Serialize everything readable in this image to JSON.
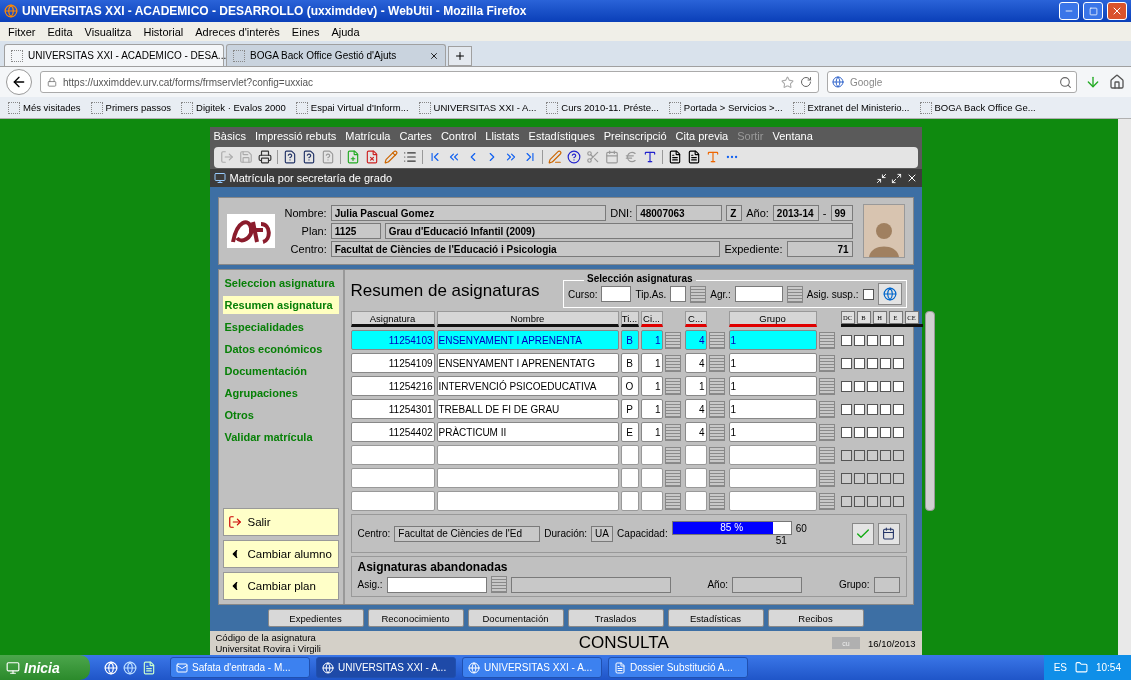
{
  "browser": {
    "title": "UNIVERSITAS XXI - ACADEMICO - DESARROLLO (uxximddev) - WebUtil - Mozilla Firefox",
    "menu": [
      {
        "label": "Fitxer"
      },
      {
        "label": "Edita"
      },
      {
        "label": "Visualitza"
      },
      {
        "label": "Historial"
      },
      {
        "label": "Adreces d'interès"
      },
      {
        "label": "Eines"
      },
      {
        "label": "Ajuda"
      }
    ],
    "tabs": [
      {
        "label": "UNIVERSITAS XXI - ACADEMICO - DESA...",
        "selected": true
      },
      {
        "label": "BOGA  Back Office Gestió d'Ajuts",
        "selected": false
      }
    ],
    "url": "https://uxximddev.urv.cat/forms/frmservlet?config=uxxiac",
    "search_placeholder": "Google",
    "bookmarks": [
      {
        "label": "Més visitades"
      },
      {
        "label": "Primers passos"
      },
      {
        "label": "Digitek · Evalos 2000"
      },
      {
        "label": "Espai Virtual d'Inform..."
      },
      {
        "label": "UNIVERSITAS XXI - A..."
      },
      {
        "label": "Curs 2010-11. Préste..."
      },
      {
        "label": "Portada > Servicios >..."
      },
      {
        "label": "Extranet del Ministerio..."
      },
      {
        "label": "BOGA  Back Office Ge..."
      }
    ]
  },
  "app": {
    "menu": [
      {
        "label": "Bàsics",
        "disabled": false
      },
      {
        "label": "Impressió rebuts",
        "disabled": false
      },
      {
        "label": "Matrícula",
        "disabled": false
      },
      {
        "label": "Cartes",
        "disabled": false
      },
      {
        "label": "Control",
        "disabled": false
      },
      {
        "label": "Llistats",
        "disabled": false
      },
      {
        "label": "Estadístiques",
        "disabled": false
      },
      {
        "label": "Preinscripció",
        "disabled": false
      },
      {
        "label": "Cita previa",
        "disabled": false
      },
      {
        "label": "Sortir",
        "disabled": true
      },
      {
        "label": "Ventana",
        "disabled": false
      }
    ],
    "window_title": "Matrícula por secretaría de grado",
    "header": {
      "nombre": {
        "label": "Nombre:",
        "value": "Julia Pascual Gomez"
      },
      "dni": {
        "label": "DNI:",
        "value": "48007063",
        "letter": "Z"
      },
      "ano": {
        "label": "Año:",
        "value": "2013-14",
        "separator": "-",
        "suffix": "99"
      },
      "plan": {
        "label": "Plan:",
        "code": "1125",
        "name": "Grau d'Educació Infantil (2009)"
      },
      "centro": {
        "label": "Centro:",
        "value": "Facultat de Ciències de l'Educació i Psicologia"
      },
      "expediente": {
        "label": "Expediente:",
        "value": "71"
      }
    },
    "nav": [
      {
        "label": "Seleccion asignatura",
        "selected": false
      },
      {
        "label": "Resumen asignatura",
        "selected": true
      },
      {
        "label": "Especialidades",
        "selected": false
      },
      {
        "label": "Datos económicos",
        "selected": false
      },
      {
        "label": "Documentación",
        "selected": false
      },
      {
        "label": "Agrupaciones",
        "selected": false
      },
      {
        "label": "Otros",
        "selected": false
      },
      {
        "label": "Validar matrícula",
        "selected": false
      }
    ],
    "side_buttons": [
      {
        "label": "Salir",
        "kind": "exit"
      },
      {
        "label": "Cambiar alumno",
        "kind": "arrow"
      },
      {
        "label": "Cambiar plan",
        "kind": "arrow"
      }
    ],
    "summary": {
      "title": "Resumen de asignaturas",
      "selection": {
        "legend": "Selección asignaturas",
        "curso": "Curso:",
        "tipas": "Tip.As.",
        "agr": "Agr.:",
        "susp": "Asig. susp.:",
        "susp_checked": false
      },
      "columns": [
        "Asignatura",
        "Nombre",
        "Ti...",
        "Ci...",
        "C...",
        "Grupo"
      ],
      "flag_columns": [
        "DC",
        "B",
        "H",
        "E",
        "CE"
      ],
      "rows": [
        {
          "asignatura": "11254103",
          "nombre": "ENSENYAMENT I APRENENTA",
          "tipo": "B",
          "ciclo": "1",
          "curso": "4",
          "grupo": "1",
          "selected": true,
          "flags": [
            false,
            false,
            false,
            false,
            false
          ]
        },
        {
          "asignatura": "11254109",
          "nombre": "ENSENYAMENT I APRENENTATG",
          "tipo": "B",
          "ciclo": "1",
          "curso": "4",
          "grupo": "1",
          "selected": false,
          "flags": [
            false,
            false,
            false,
            false,
            false
          ]
        },
        {
          "asignatura": "11254216",
          "nombre": "INTERVENCIÓ PSICOEDUCATIVA",
          "tipo": "O",
          "ciclo": "1",
          "curso": "1",
          "grupo": "1",
          "selected": false,
          "flags": [
            false,
            false,
            false,
            false,
            false
          ]
        },
        {
          "asignatura": "11254301",
          "nombre": "TREBALL DE FI DE GRAU",
          "tipo": "P",
          "ciclo": "1",
          "curso": "4",
          "grupo": "1",
          "selected": false,
          "flags": [
            false,
            false,
            false,
            false,
            false
          ]
        },
        {
          "asignatura": "11254402",
          "nombre": "PRÀCTICUM II",
          "tipo": "E",
          "ciclo": "1",
          "curso": "4",
          "grupo": "1",
          "selected": false,
          "flags": [
            false,
            false,
            false,
            false,
            false
          ]
        }
      ],
      "empty_rows": [
        {
          "flags": [
            false,
            false,
            false,
            false,
            false
          ]
        },
        {
          "flags": [
            false,
            false,
            false,
            false,
            false
          ]
        },
        {
          "flags": [
            false,
            false,
            false,
            false,
            false
          ]
        }
      ],
      "info": {
        "centro_label": "Centro:",
        "centro": "Facultat de Ciències de l'Ed",
        "duracion_label": "Duración:",
        "duracion": "UA",
        "capacidad_label": "Capacidad:",
        "capacidad": {
          "level": 0.85,
          "reading": "85 %"
        },
        "max": "60",
        "count": "51"
      },
      "abandoned": {
        "title": "Asignaturas abandonadas",
        "asig": "Asig.:",
        "ano": "Año:",
        "grupo": "Grupo:"
      }
    },
    "bottom_buttons": [
      "Expedientes",
      "Reconocimiento",
      "Documentación",
      "Traslados",
      "Estadísticas",
      "Recibos"
    ],
    "status": {
      "hint": "Código de la asignatura",
      "org": "Universitat Rovira i Virgili",
      "mode": "CONSULTA",
      "indicator": "cu",
      "date": "16/10/2013"
    }
  },
  "taskbar": {
    "start": "Inicia",
    "items": [
      {
        "label": "Safata d'entrada - M...",
        "selected": false
      },
      {
        "label": "UNIVERSITAS XXI - A...",
        "selected": true
      },
      {
        "label": "UNIVERSITAS XXI - A...",
        "selected": false
      },
      {
        "label": "Dossier Substitució A...",
        "selected": false
      }
    ],
    "lang": "ES",
    "time": "10:54"
  }
}
